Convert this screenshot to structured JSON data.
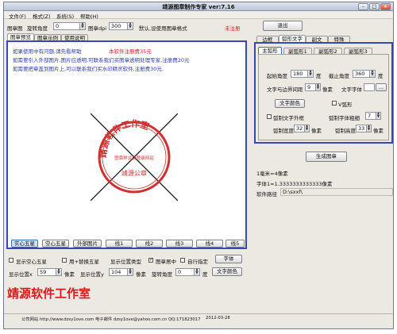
{
  "window": {
    "title": "靖源图章制作专家 ver:7.16"
  },
  "menu": [
    "文件(F)",
    "格式(Z)",
    "系统(S)",
    "帮助(H)"
  ],
  "toolbar": {
    "stamp_label": "图章图",
    "rotate_label": "旋转角度",
    "rotate_value": "0",
    "dpi_label": "图章dpi",
    "dpi_value": "300",
    "default_note": "默认,设使用图章格式",
    "unregistered": "未注册",
    "exit_button": "退出"
  },
  "left_tabs": [
    "图章预览",
    "图章示例",
    "使用说明"
  ],
  "notice": {
    "line1": "如果使用中有问题,请先看帮助",
    "line1_red": "本软件注册费35元",
    "line2": "如需要引入外部图片,图片应透明,可联系我们买图章透明处理专家,注册费20元",
    "line3": "如需要把章盖到图片上,可以联系我们买水印精灵软件,注册费30元."
  },
  "stamp": {
    "top_text": "靖源软件工作室",
    "inner_text": "图章样式请登录网站",
    "bottom_text": "靖源公章",
    "color": "#d03030"
  },
  "shape_buttons": [
    "实心五星",
    "空心五星",
    "外部图片",
    "线1",
    "线2",
    "线3",
    "线4",
    "线5"
  ],
  "options": {
    "show_hollow_star": "显示空心五星",
    "use_replace_star": "用+替换五星",
    "show_position_type": "显示位置类型",
    "stamp_center": "图章居中",
    "custom": "自行指定",
    "font_button": "字体",
    "pos_x_label": "显示位置x",
    "pos_x_value": "59",
    "unit1": "像素",
    "pos_y_label": "显示位置y",
    "pos_y_value": "104",
    "unit2": "像素",
    "rotate_label": "旋转角度",
    "rotate_value": "0",
    "unit3": "度",
    "text_color_button": "文字颜色"
  },
  "preview_text": "靖源软件工作室",
  "status_bar": {
    "site": "公司网站 http://www.dzsy1ove.com 电子邮件 dzsy1ove@yahoo.com.cn QQ:171823017",
    "date": "2012-03-28"
  },
  "right_tabs": [
    "边框",
    "弧形文字",
    "副文",
    "特殊"
  ],
  "right_subtabs": [
    "主弧形",
    "副弧形1",
    "副弧形2",
    "副弧形3"
  ],
  "arc": {
    "start_label": "起始角度",
    "start_value": "180",
    "unit_deg1": "度",
    "end_label": "截止角度",
    "end_value": "360",
    "unit_deg2": "度",
    "gap_label": "文字与边界间距",
    "gap_value": "9",
    "unit_px": "像素",
    "font_label": "文字字体",
    "font_value": "",
    "font_dots": "...",
    "color_button": "文字颜色",
    "v_shape": "V弧形",
    "outline": "弧制文字外框",
    "weight_label": "弧制字体粗细",
    "weight_value": "7",
    "width_label": "弧制宽度",
    "width_value": "32",
    "unit_px2": "像素",
    "height_label": "弧制高度",
    "height_value": "33",
    "unit_px3": "像素"
  },
  "generate_button": "生成图章",
  "info": {
    "line1": "1毫米=4像素",
    "line2": "字体1=1.3333333333333像素",
    "path_label": "软件路径",
    "path_value": "D:\\sxxf\\"
  }
}
